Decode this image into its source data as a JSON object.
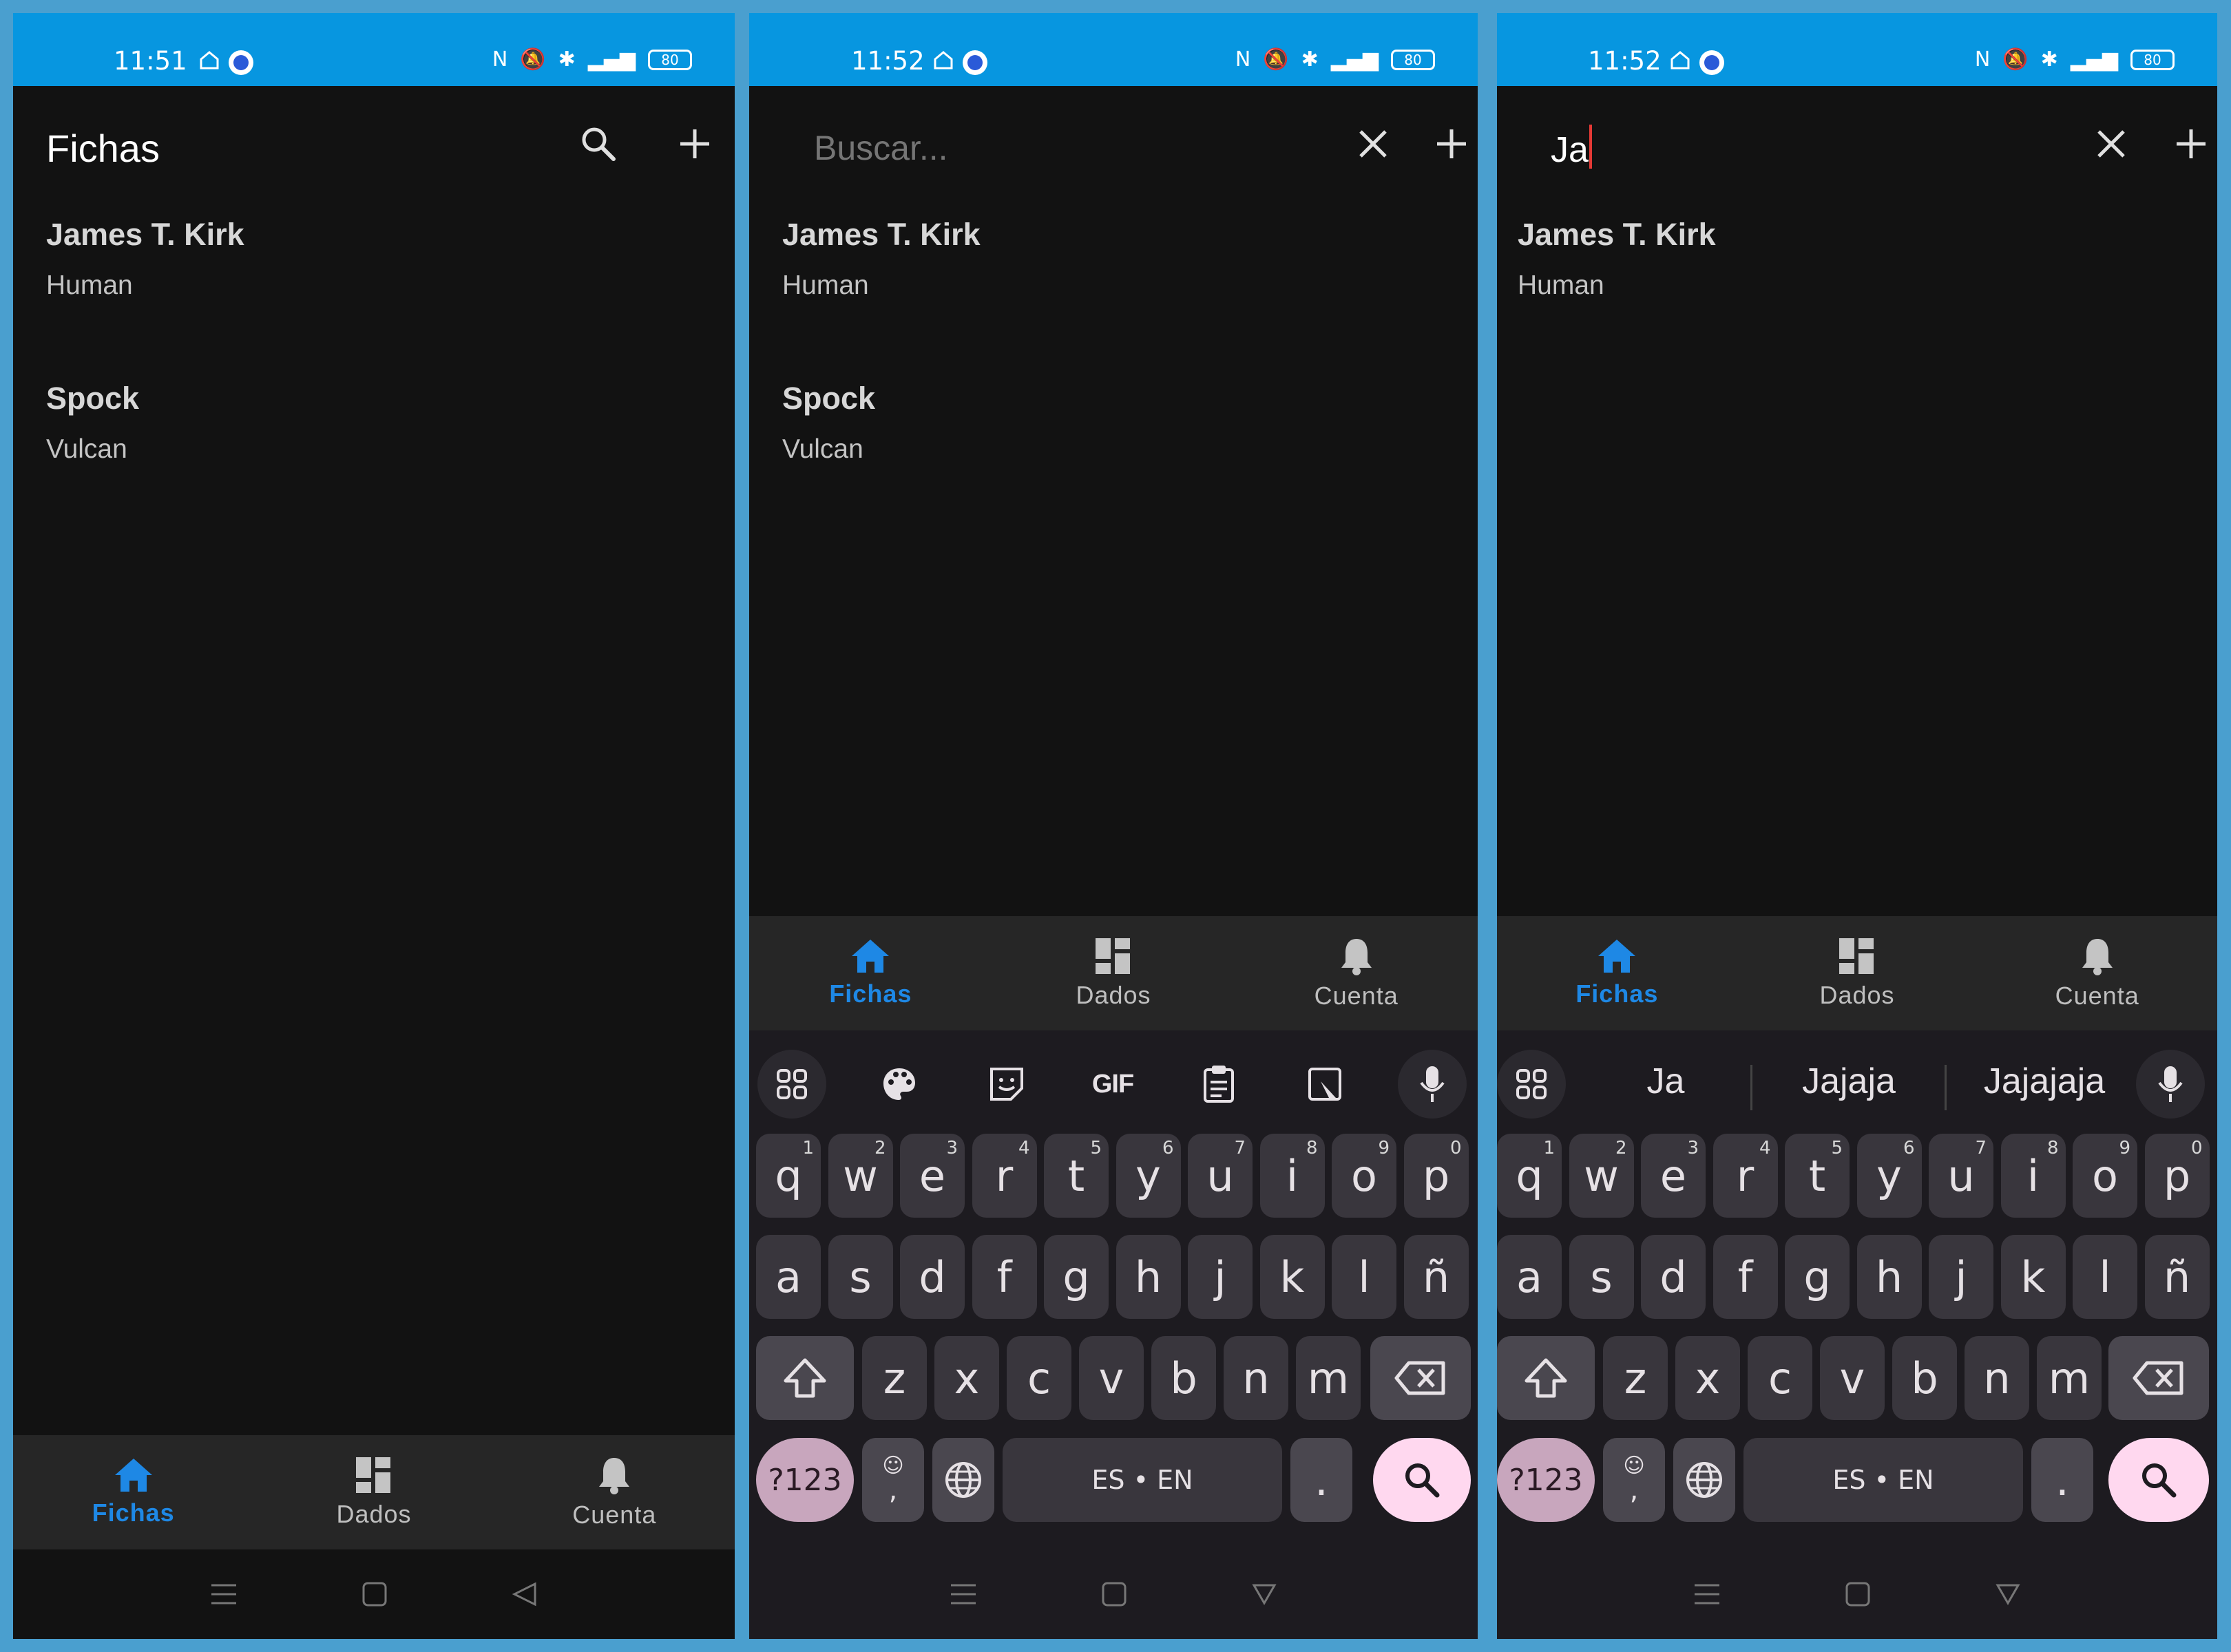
{
  "screens": [
    {
      "status": {
        "time": "11:51",
        "battery": "80"
      },
      "appbar": {
        "title": "Fichas"
      },
      "items": [
        {
          "name": "James T. Kirk",
          "species": "Human"
        },
        {
          "name": "Spock",
          "species": "Vulcan"
        }
      ]
    },
    {
      "status": {
        "time": "11:52",
        "battery": "80"
      },
      "appbar": {
        "placeholder": "Buscar..."
      },
      "items": [
        {
          "name": "James T. Kirk",
          "species": "Human"
        },
        {
          "name": "Spock",
          "species": "Vulcan"
        }
      ]
    },
    {
      "status": {
        "time": "11:52",
        "battery": "80"
      },
      "appbar": {
        "query": "Ja"
      },
      "items": [
        {
          "name": "James T. Kirk",
          "species": "Human"
        }
      ],
      "suggestions": [
        "Ja",
        "Jajaja",
        "Jajajaja"
      ]
    }
  ],
  "nav": {
    "fichas": "Fichas",
    "dados": "Dados",
    "cuenta": "Cuenta"
  },
  "keyboard": {
    "row1": [
      "q",
      "w",
      "e",
      "r",
      "t",
      "y",
      "u",
      "i",
      "o",
      "p"
    ],
    "row1_hints": [
      "1",
      "2",
      "3",
      "4",
      "5",
      "6",
      "7",
      "8",
      "9",
      "0"
    ],
    "row2": [
      "a",
      "s",
      "d",
      "f",
      "g",
      "h",
      "j",
      "k",
      "l",
      "ñ"
    ],
    "row3": [
      "z",
      "x",
      "c",
      "v",
      "b",
      "n",
      "m"
    ],
    "symbols": "?123",
    "space": "ES • EN",
    "period": ".",
    "comma": ","
  },
  "colors": {
    "status_bar": "#0796e0",
    "accent": "#1e88e5",
    "background": "#121212",
    "frame": "#4a9fcf"
  }
}
